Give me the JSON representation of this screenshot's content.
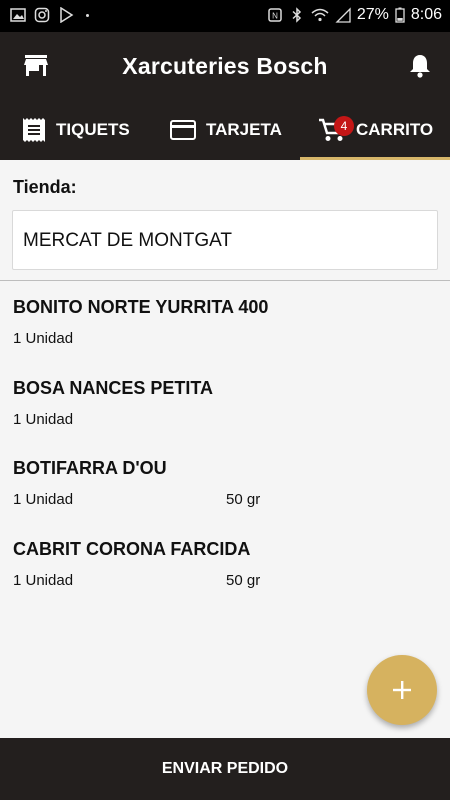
{
  "status_bar": {
    "battery": "27%",
    "time": "8:06"
  },
  "app": {
    "title": "Xarcuteries Bosch"
  },
  "tabs": [
    {
      "label": "TIQUETS"
    },
    {
      "label": "TARJETA"
    },
    {
      "label": "CARRITO",
      "badge": "4",
      "active": true
    }
  ],
  "store": {
    "label": "Tienda:",
    "value": "MERCAT DE MONTGAT"
  },
  "items": [
    {
      "name": "BONITO NORTE YURRITA 400",
      "qty": "1 Unidad",
      "weight": ""
    },
    {
      "name": "BOSA NANCES PETITA",
      "qty": "1 Unidad",
      "weight": ""
    },
    {
      "name": "BOTIFARRA D'OU",
      "qty": "1 Unidad",
      "weight": "50 gr"
    },
    {
      "name": "CABRIT CORONA FARCIDA",
      "qty": "1 Unidad",
      "weight": "50 gr"
    }
  ],
  "actions": {
    "fab": "+",
    "submit": "ENVIAR PEDIDO"
  },
  "colors": {
    "bar": "#231f1e",
    "accent": "#d6b25f",
    "badge": "#c41616"
  }
}
